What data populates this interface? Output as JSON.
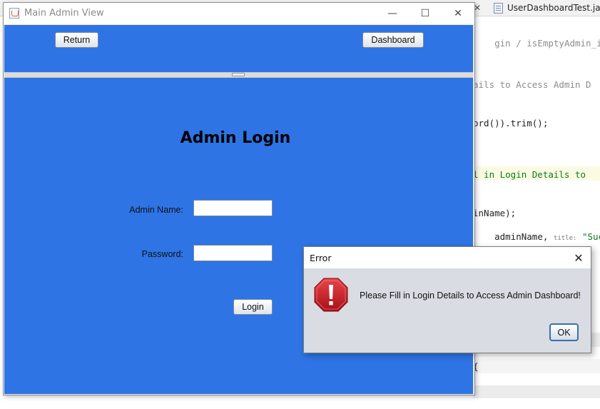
{
  "ide": {
    "tabs": [
      {
        "label": "UserDashboardTest.java"
      }
    ],
    "code_lines": [
      {
        "text": "gin",
        "suffix": " / ",
        "rest": "isEmptyAdmin_inde",
        "class": "gray"
      },
      {
        "text": "ails to Access Admin D",
        "class": "gray"
      },
      {
        "text": "ord()).trim();",
        "class": ""
      },
      {
        "text": "l in Login Details to ",
        "class": "green"
      },
      {
        "text": "inName);",
        "class": ""
      },
      {
        "prefix": "adminName, ",
        "hint": "title:",
        "string": " \"Succe",
        "class": ""
      },
      {
        "text": "{",
        "class": ""
      }
    ]
  },
  "window": {
    "title": "Main Admin View",
    "minimize_glyph": "—",
    "maximize_glyph": "☐",
    "close_glyph": "✕"
  },
  "top_panel": {
    "return_label": "Return",
    "dashboard_label": "Dashboard"
  },
  "login_form": {
    "title": "Admin Login",
    "admin_name_label": "Admin Name:",
    "admin_name_value": "",
    "password_label": "Password:",
    "password_value": "",
    "login_label": "Login"
  },
  "error_dialog": {
    "title": "Error",
    "close_glyph": "✕",
    "icon": "error-octagon-icon",
    "message": "Please Fill in Login Details to Access Admin Dashboard!",
    "ok_label": "OK"
  },
  "colors": {
    "panel_blue": "#2e74e5",
    "error_red": "#c8161d",
    "dialog_bg": "#d9dce2"
  }
}
